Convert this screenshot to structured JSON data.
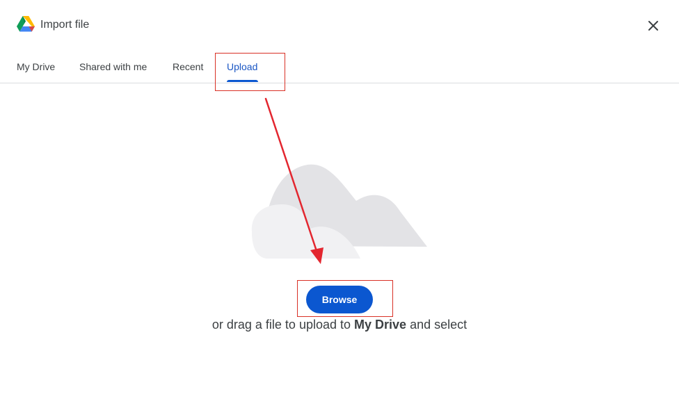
{
  "header": {
    "logo_icon": "google-drive-icon",
    "title": "Import file",
    "close_icon": "close-icon"
  },
  "tabs": [
    {
      "label": "My Drive",
      "active": false
    },
    {
      "label": "Shared with me",
      "active": false
    },
    {
      "label": "Recent",
      "active": false
    },
    {
      "label": "Upload",
      "active": true
    }
  ],
  "upload": {
    "illustration_icon": "cloud-icon",
    "browse_label": "Browse",
    "hint_prefix": "or drag a file to upload to ",
    "hint_location": "My Drive",
    "hint_suffix": " and select"
  },
  "colors": {
    "accent": "#0b57d0",
    "active_tab_text": "#1a56c4",
    "annotation": "#d93025",
    "cloud_dark": "#e3e3e6",
    "cloud_light": "#f1f1f3"
  }
}
